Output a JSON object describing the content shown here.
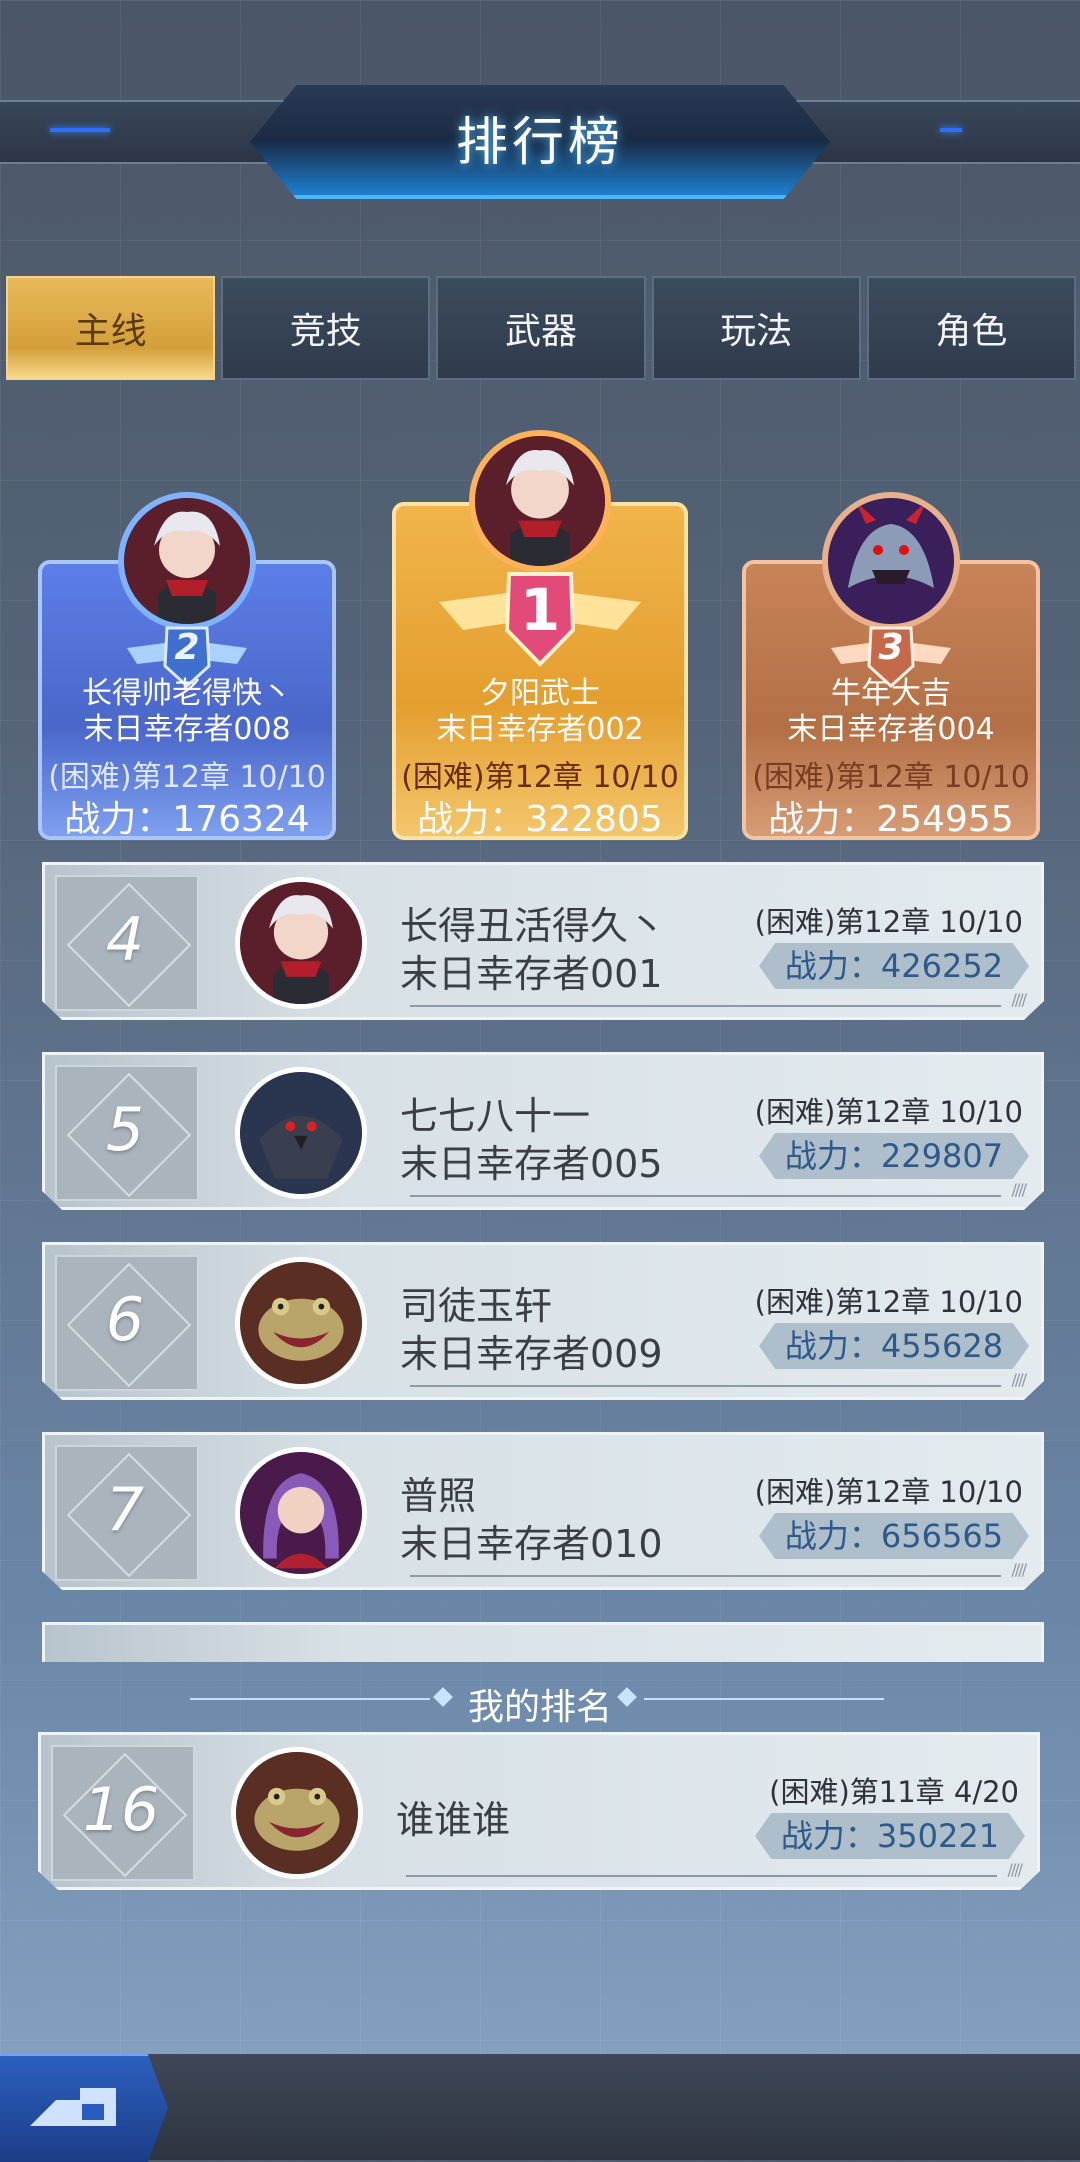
{
  "title": "排行榜",
  "tabs": [
    {
      "label": "主线",
      "active": true
    },
    {
      "label": "竞技",
      "active": false
    },
    {
      "label": "武器",
      "active": false
    },
    {
      "label": "玩法",
      "active": false
    },
    {
      "label": "角色",
      "active": false
    }
  ],
  "podium": {
    "first": {
      "rank": "1",
      "line1": "夕阳武士",
      "line2": "末日幸存者002",
      "stage": "(困难)第12章 10/10",
      "power": "战力：322805",
      "avatar_icon": "silver-hair-warrior-icon"
    },
    "second": {
      "rank": "2",
      "line1": "长得帅老得快丶",
      "line2": "末日幸存者008",
      "stage": "(困难)第12章 10/10",
      "power": "战力：176324",
      "avatar_icon": "silver-hair-warrior-icon"
    },
    "third": {
      "rank": "3",
      "line1": "牛年大吉",
      "line2": "末日幸存者004",
      "stage": "(困难)第12章 10/10",
      "power": "战力：254955",
      "avatar_icon": "purple-dragon-icon"
    }
  },
  "list": [
    {
      "rank": "4",
      "line1": "长得丑活得久丶",
      "line2": "末日幸存者001",
      "stage": "(困难)第12章 10/10",
      "power": "战力：426252",
      "avatar_icon": "silver-hair-warrior-icon"
    },
    {
      "rank": "5",
      "line1": "七七八十一",
      "line2": "末日幸存者005",
      "stage": "(困难)第12章 10/10",
      "power": "战力：229807",
      "avatar_icon": "dark-crow-icon"
    },
    {
      "rank": "6",
      "line1": "司徒玉轩",
      "line2": "末日幸存者009",
      "stage": "(困难)第12章 10/10",
      "power": "战力：455628",
      "avatar_icon": "toad-monster-icon"
    },
    {
      "rank": "7",
      "line1": "普照",
      "line2": "末日幸存者010",
      "stage": "(困难)第12章 10/10",
      "power": "战力：656565",
      "avatar_icon": "purple-hair-girl-icon"
    }
  ],
  "my_rank_label": "我的排名",
  "my_rank": {
    "rank": "16",
    "line1": "谁谁谁",
    "stage": "(困难)第11章 4/20",
    "power": "战力：350221",
    "avatar_icon": "toad-monster-icon"
  },
  "back_icon": "back-arrow-icon",
  "colors": {
    "tab_active": "#d49f3a",
    "gold": "#e49e2e",
    "silver_blue": "#4a67c9",
    "bronze": "#b36f45",
    "power_text": "#2d5a8a"
  }
}
